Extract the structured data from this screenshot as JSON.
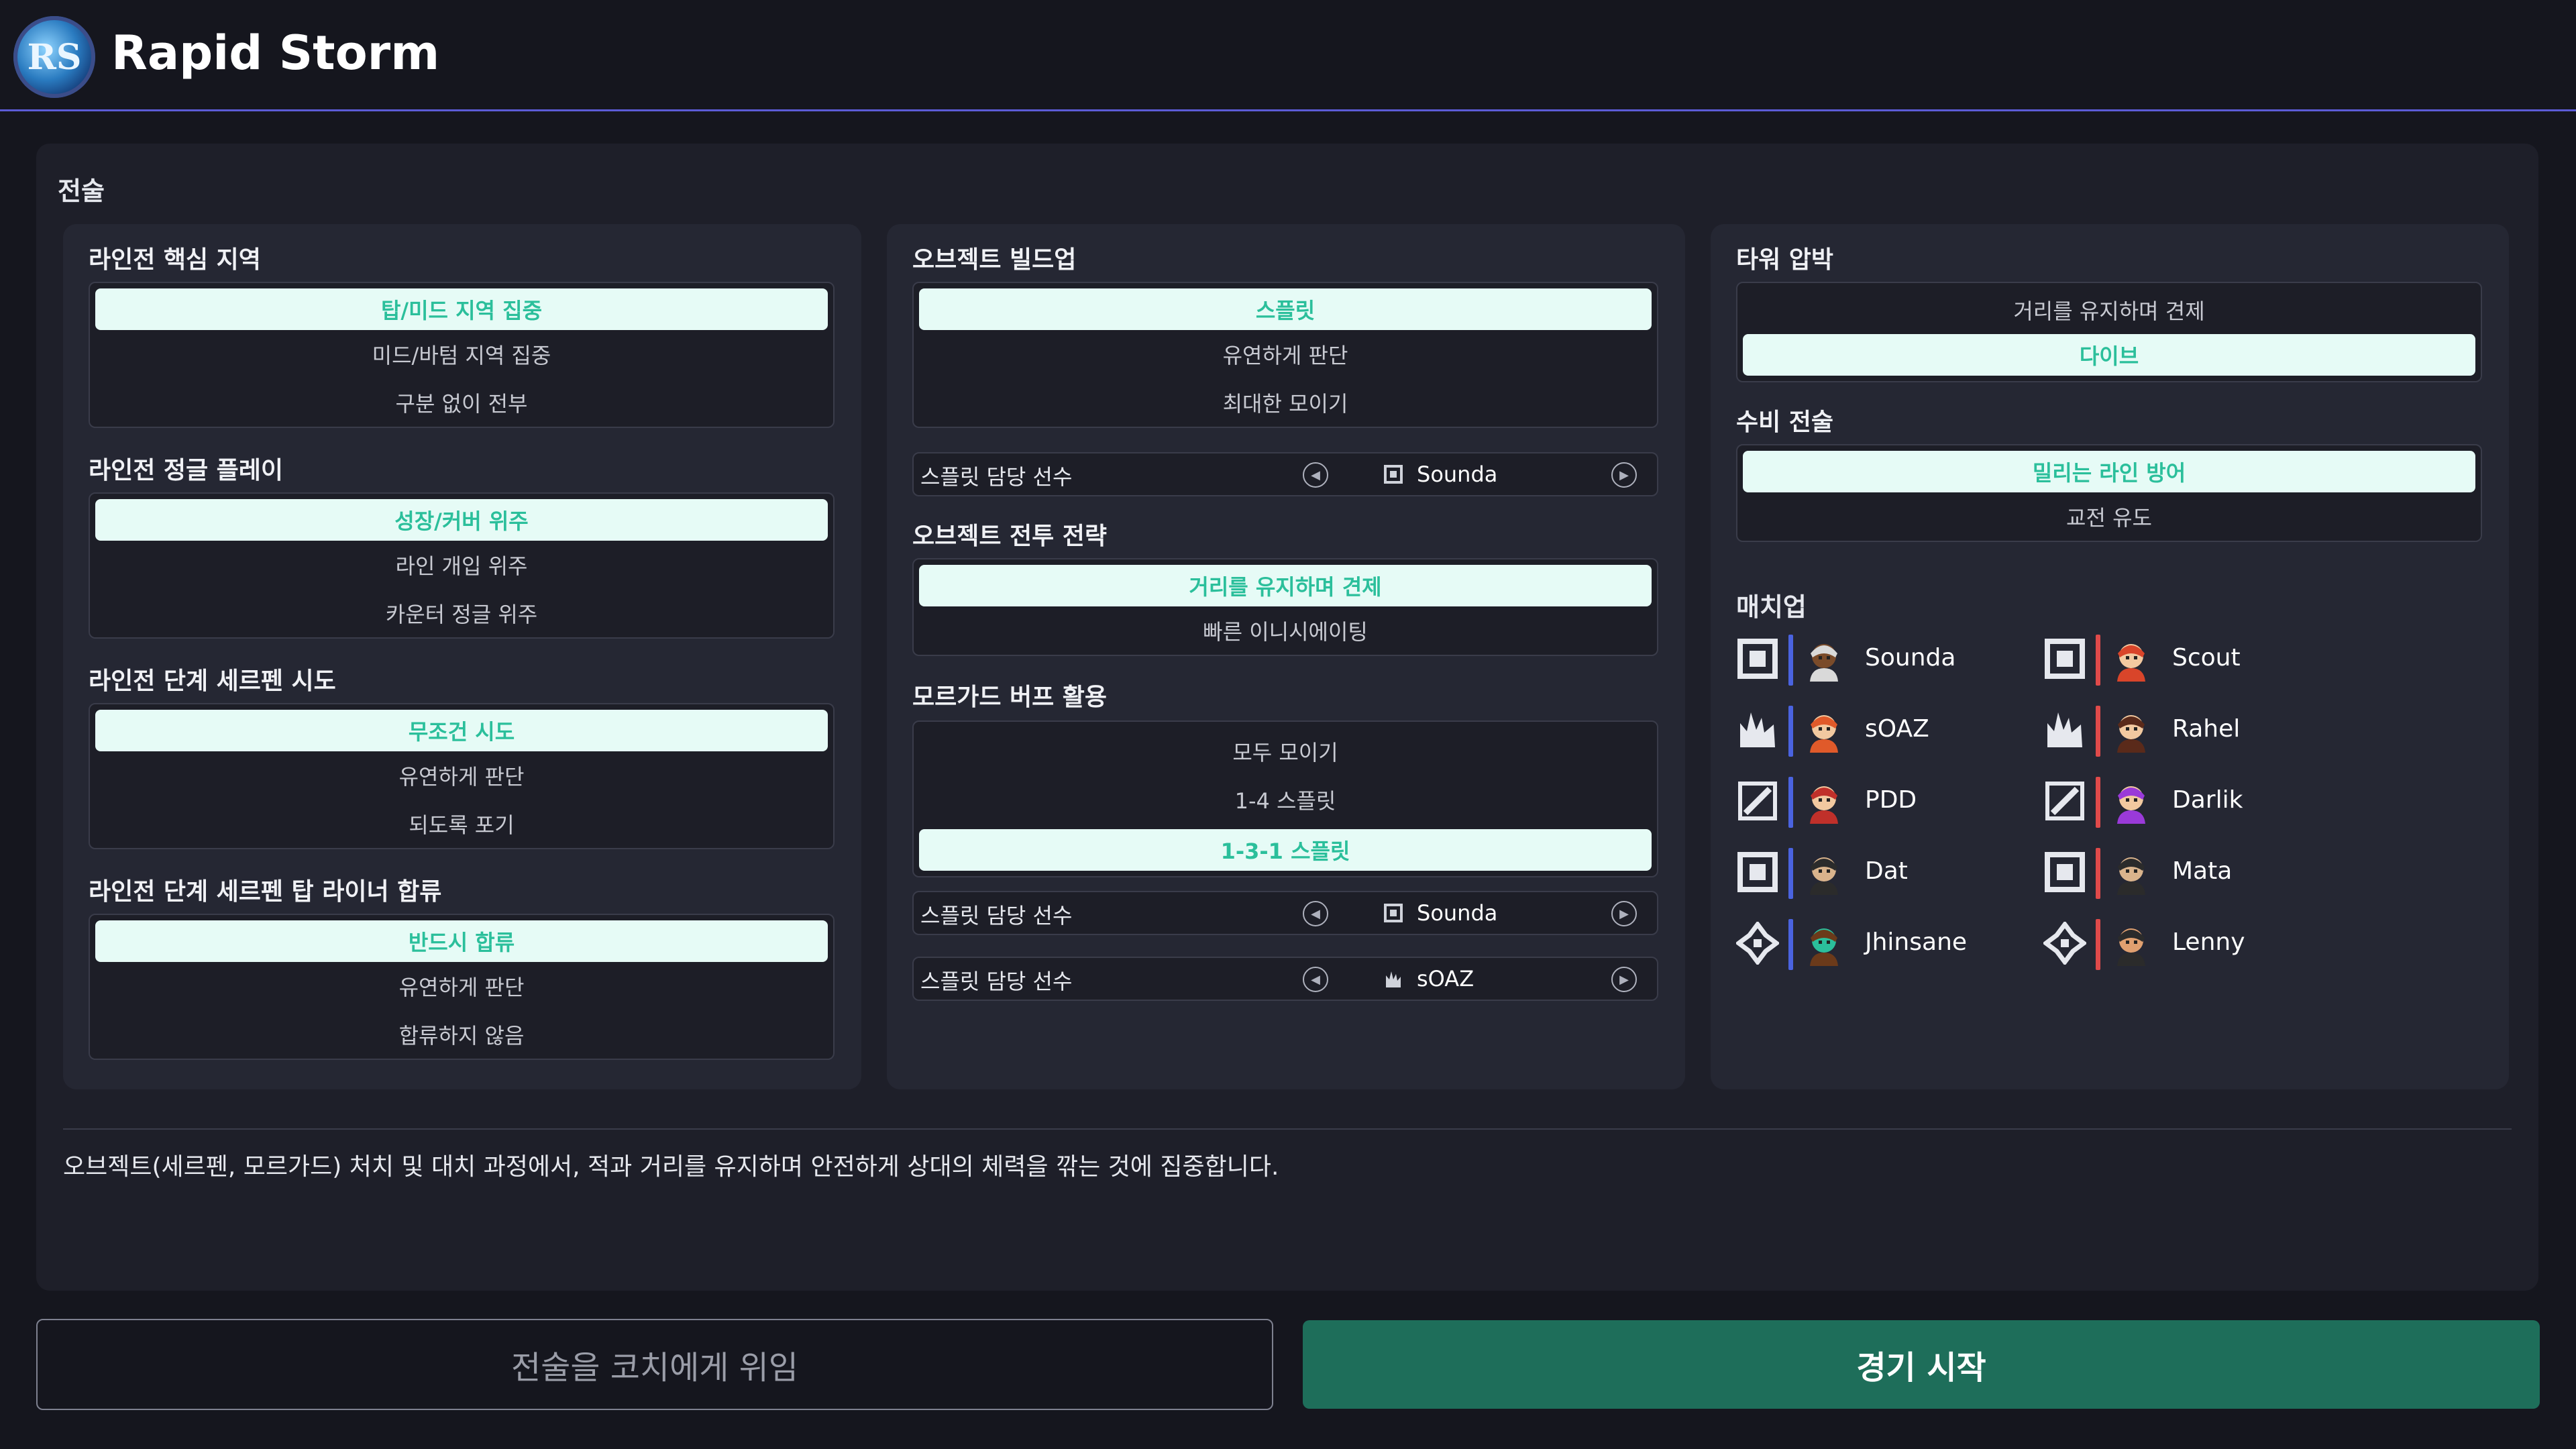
{
  "header": {
    "app_title": "Rapid Storm",
    "logo_text": "RS"
  },
  "main": {
    "title": "전술",
    "col1": {
      "s1": {
        "title": "라인전 핵심 지역",
        "options": [
          "탑/미드 지역 집중",
          "미드/바텀 지역 집중",
          "구분 없이 전부"
        ]
      },
      "s2": {
        "title": "라인전 정글 플레이",
        "options": [
          "성장/커버 위주",
          "라인 개입 위주",
          "카운터 정글 위주"
        ]
      },
      "s3": {
        "title": "라인전 단계 세르펜 시도",
        "options": [
          "무조건 시도",
          "유연하게 판단",
          "되도록 포기"
        ]
      },
      "s4": {
        "title": "라인전 단계 세르펜 탑 라이너 합류",
        "options": [
          "반드시 합류",
          "유연하게 판단",
          "합류하지 않음"
        ]
      }
    },
    "col2": {
      "s1": {
        "title": "오브젝트 빌드업",
        "options": [
          "스플릿",
          "유연하게 판단",
          "최대한 모이기"
        ]
      },
      "p1": {
        "label": "스플릿 담당 선수",
        "player": "Sounda"
      },
      "s2": {
        "title": "오브젝트 전투 전략",
        "options": [
          "거리를 유지하며 견제",
          "빠른 이니시에이팅"
        ]
      },
      "s3": {
        "title": "모르가드 버프 활용",
        "options": [
          "모두 모이기",
          "1-4 스플릿",
          "1-3-1 스플릿"
        ]
      },
      "p2": {
        "label": "스플릿 담당 선수",
        "player": "Sounda"
      },
      "p3": {
        "label": "스플릿 담당 선수",
        "player": "sOAZ"
      }
    },
    "col3": {
      "s1": {
        "title": "타워 압박",
        "options": [
          "거리를 유지하며 견제",
          "다이브"
        ]
      },
      "s2": {
        "title": "수비 전술",
        "options": [
          "밀리는 라인 방어",
          "교전 유도"
        ]
      },
      "matchup": {
        "title": "매치업",
        "blue": [
          "Sounda",
          "sOAZ",
          "PDD",
          "Dat",
          "Jhinsane"
        ],
        "red": [
          "Scout",
          "Rahel",
          "Darlik",
          "Mata",
          "Lenny"
        ],
        "roles": [
          "top-role-icon",
          "jungle-role-icon",
          "mid-role-icon",
          "bot-role-icon",
          "support-role-icon"
        ],
        "blue_color": "#4a63e0",
        "red_color": "#e04a4a"
      }
    },
    "description": "오브젝트(세르펜, 모르가드) 처치 및 대치 과정에서, 적과 거리를 유지하며 안전하게 상대의 체력을 깎는 것에 집중합니다."
  },
  "footer": {
    "delegate_label": "전술을 코치에게 위임",
    "start_label": "경기 시작"
  },
  "colors": {
    "accent": "#2bbf9b",
    "selected_bg": "#e6fbf6",
    "start_button": "#1e6e5a",
    "header_line": "#5c5cd6"
  }
}
